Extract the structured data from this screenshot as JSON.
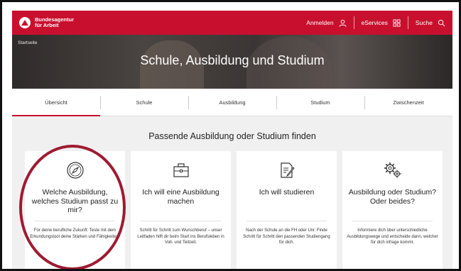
{
  "header": {
    "logo_line1": "Bundesagentur",
    "logo_line2": "für Arbeit",
    "nav": [
      {
        "label": "Anmelden",
        "icon": "user-icon"
      },
      {
        "label": "eServices",
        "icon": "grid-icon"
      },
      {
        "label": "Suche",
        "icon": "search-icon"
      }
    ],
    "accent": "#c8102e"
  },
  "hero": {
    "breadcrumb": "Startseite",
    "title": "Schule, Ausbildung und Studium"
  },
  "tabs": [
    {
      "label": "Übersicht",
      "active": true
    },
    {
      "label": "Schule",
      "active": false
    },
    {
      "label": "Ausbildung",
      "active": false
    },
    {
      "label": "Studium",
      "active": false
    },
    {
      "label": "Zwischenzeit",
      "active": false
    }
  ],
  "section": {
    "title": "Passende Ausbildung oder Studium finden"
  },
  "cards": [
    {
      "icon": "compass-icon",
      "title": "Welche Ausbildung, welches Studium passt zu mir?",
      "text": "Für deine berufliche Zukunft: Teste mit dem Erkundungstool deine Stärken und Fähigkeiten."
    },
    {
      "icon": "briefcase-icon",
      "title": "Ich will eine Ausbildung machen",
      "text": "Schritt für Schritt zum Wunschberuf – unser Leitfaden hilft dir beim Start ins Berufsleben in Voll- und Teilzeit."
    },
    {
      "icon": "document-edit-icon",
      "title": "Ich will studieren",
      "text": "Nach der Schule an die FH oder Uni: Finde Schritt für Schritt den passenden Studiengang für dich."
    },
    {
      "icon": "gears-icon",
      "title": "Ausbildung oder Studium? Oder beides?",
      "text": "Informiere dich über unterschiedliche Ausbildungswege und entscheide dann, welcher für dich infrage kommt."
    }
  ],
  "annotation_color": "#9e1b32"
}
